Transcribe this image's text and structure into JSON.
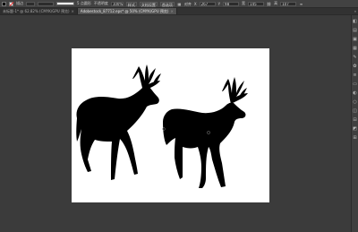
{
  "control_bar": {
    "fill_color": "#000000",
    "stroke_color": "none",
    "stroke_label": "描边",
    "stroke_weight": "",
    "variable_width": "",
    "stroke_style_label": "5 点圆形",
    "opacity_label": "不透明度",
    "opacity_value": "100%",
    "style_label": "样式",
    "doc_setup_label": "文档设置",
    "preferences_label": "首选项",
    "align_label": "对齐",
    "x_label": "X",
    "x_value": "267 mm",
    "y_label": "Y",
    "y_value": "98 mm",
    "w_label": "宽",
    "w_value": "145 mm",
    "h_label": "高",
    "h_value": "107 mm"
  },
  "tabs": [
    {
      "label": "未标题-1* @ 62.82% (CMYK/GPU 预览)",
      "active": false,
      "close": "×"
    },
    {
      "label": "Adobestock_87712.eps* @ 50% (CMYK/GPU 预览)",
      "active": true,
      "close": "×"
    }
  ],
  "right_panel": {
    "icons": [
      "layers-icon",
      "properties-icon",
      "libraries-icon",
      "swatches-icon",
      "brushes-icon",
      "symbols-icon",
      "stroke-icon",
      "gradient-icon",
      "transparency-icon",
      "appearance-icon",
      "graphic-styles-icon",
      "align-icon",
      "pathfinder-icon",
      "transform-icon"
    ]
  },
  "colors": {
    "workspace": "#3b3b3b",
    "artboard": "#ffffff",
    "silhouette": "#000000",
    "panel": "#424242"
  }
}
